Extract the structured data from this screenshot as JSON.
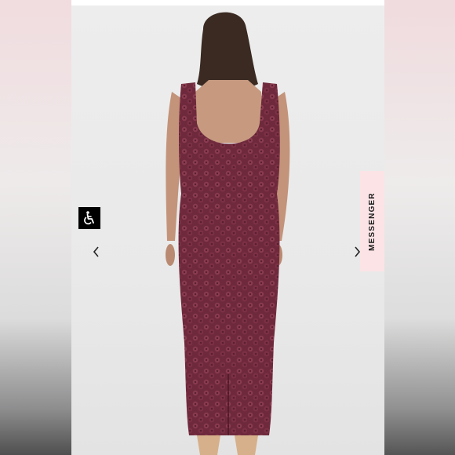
{
  "messenger_tab": {
    "label": "MESSENGER"
  },
  "icons": {
    "accessibility": "wheelchair-icon",
    "previous": "chevron-left-icon",
    "next": "chevron-right-icon"
  },
  "colors": {
    "dress": "#6e2a3c",
    "messenger_tab": "#fbe3e6",
    "accessibility_button": "#000000"
  }
}
